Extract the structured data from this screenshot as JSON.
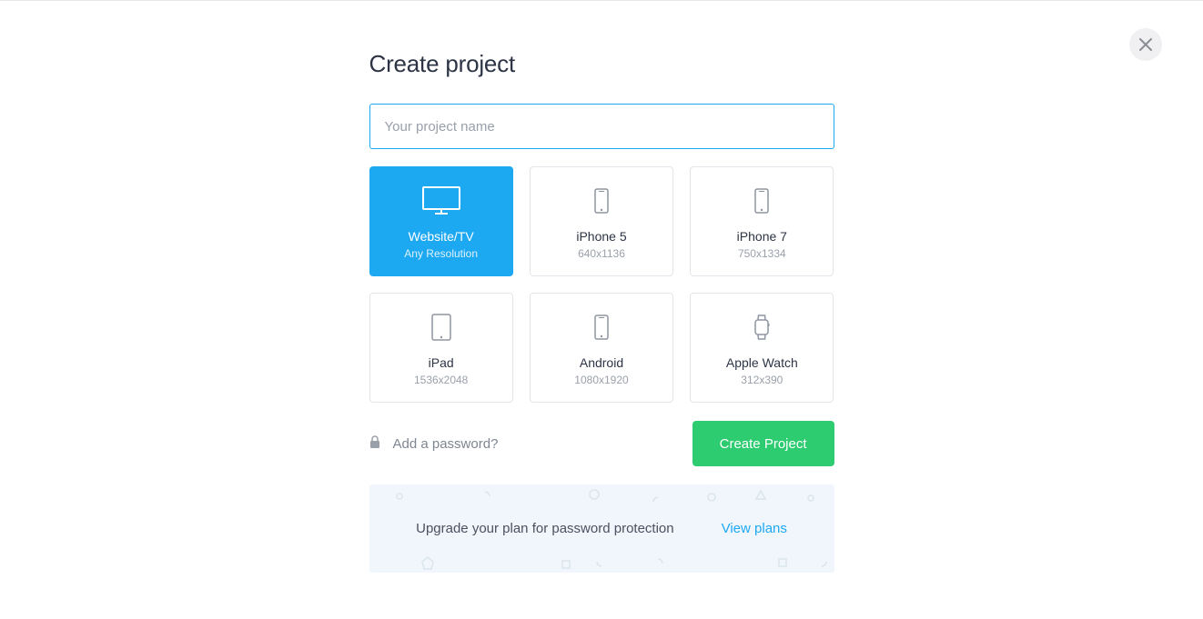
{
  "title": "Create project",
  "input": {
    "placeholder": "Your project name",
    "value": ""
  },
  "devices": [
    {
      "label": "Website/TV",
      "resolution": "Any Resolution",
      "icon": "monitor",
      "selected": true
    },
    {
      "label": "iPhone 5",
      "resolution": "640x1136",
      "icon": "phone",
      "selected": false
    },
    {
      "label": "iPhone 7",
      "resolution": "750x1334",
      "icon": "phone",
      "selected": false
    },
    {
      "label": "iPad",
      "resolution": "1536x2048",
      "icon": "tablet",
      "selected": false
    },
    {
      "label": "Android",
      "resolution": "1080x1920",
      "icon": "phone",
      "selected": false
    },
    {
      "label": "Apple Watch",
      "resolution": "312x390",
      "icon": "watch",
      "selected": false
    }
  ],
  "password_link": "Add a password?",
  "create_button": "Create Project",
  "upgrade": {
    "text": "Upgrade your plan for password protection",
    "link": "View plans"
  }
}
